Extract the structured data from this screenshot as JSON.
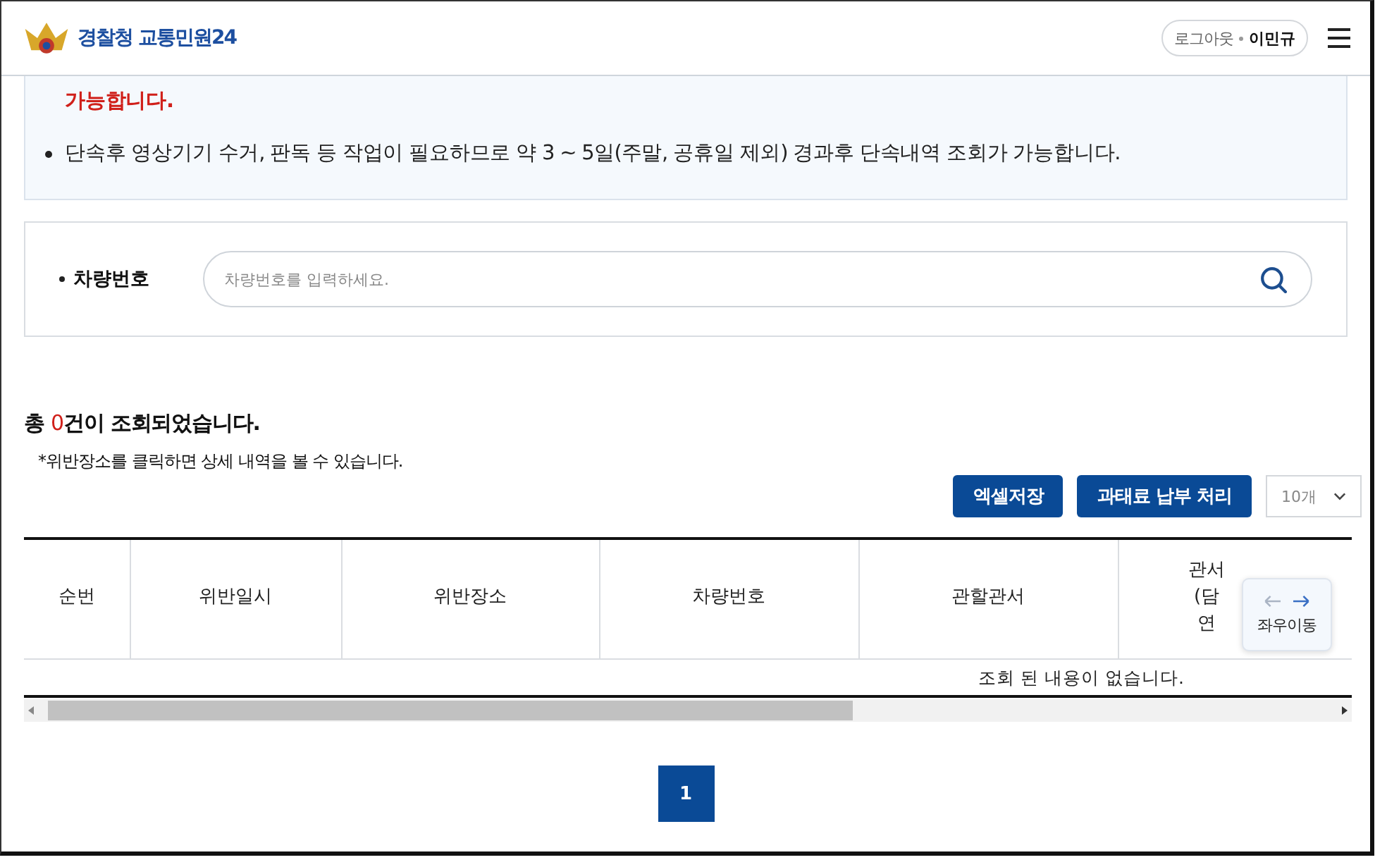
{
  "header": {
    "logo_text": "경찰청",
    "service_name": "교통민원24",
    "logout": "로그아웃",
    "user_name": "이민규"
  },
  "notices": [
    {
      "kind": "warning",
      "text": "가능합니다.",
      "bullet": false
    },
    {
      "kind": "info",
      "text": "단속후 영상기기 수거, 판독 등 작업이 필요하므로 약 3 ~ 5일(주말, 공휴일 제외) 경과후 단속내역 조회가 가능합니다.",
      "bullet": true
    }
  ],
  "search": {
    "label": "차량번호",
    "placeholder": "차량번호를 입력하세요."
  },
  "result": {
    "prefix": "총 ",
    "count": "0",
    "suffix": "건이 조회되었습니다.",
    "note": "*위반장소를 클릭하면 상세 내역을 볼 수 있습니다."
  },
  "actions": [
    "엑셀저장",
    "과태료 납부 처리"
  ],
  "page_size": "10개",
  "table": {
    "columns": [
      "순번",
      "위반일시",
      "위반장소",
      "차량번호",
      "관할관서",
      "관서\n(담\n연"
    ],
    "empty_message": "조회 된 내용이 없습니다."
  },
  "scroll_hint": "좌우이동",
  "pagination": [
    {
      "label": "1",
      "selected": true
    }
  ]
}
